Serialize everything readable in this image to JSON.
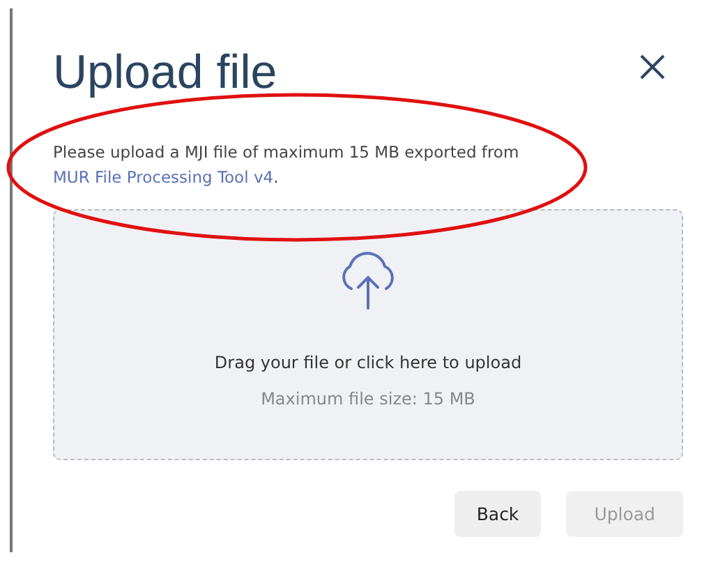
{
  "dialog": {
    "title": "Upload file",
    "description": {
      "text": "Please upload a MJI file of maximum 15 MB exported from ",
      "link": "MUR File Processing Tool v4",
      "suffix": "."
    },
    "dropzone": {
      "prompt": "Drag your file or click here to upload",
      "hint": "Maximum file size: 15 MB"
    },
    "buttons": [
      {
        "label": "Back",
        "disabled": false
      },
      {
        "label": "Upload",
        "disabled": true
      }
    ]
  }
}
